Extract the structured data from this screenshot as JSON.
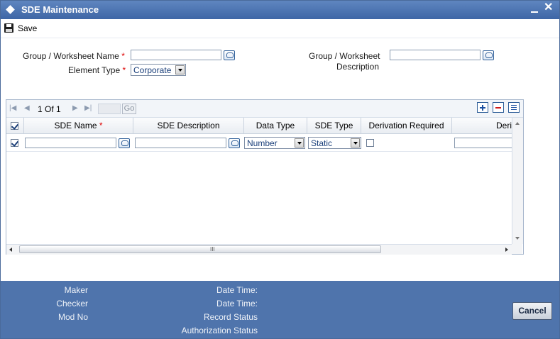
{
  "window": {
    "title": "SDE Maintenance"
  },
  "toolbar": {
    "save_label": "Save"
  },
  "form": {
    "group_name_label": "Group / Worksheet Name",
    "element_type_label": "Element Type",
    "element_type_value": "Corporate",
    "group_desc_label_line1": "Group / Worksheet",
    "group_desc_label_line2": "Description",
    "required_mark": "*"
  },
  "grid": {
    "page_current": "1",
    "page_of": "Of",
    "page_total": "1",
    "go_label": "Go",
    "columns": {
      "sde_name": "SDE Name",
      "sde_description": "SDE Description",
      "data_type": "Data Type",
      "sde_type": "SDE Type",
      "derivation_required": "Derivation Required",
      "derivation_partial": "Deri"
    },
    "row": {
      "data_type_value": "Number",
      "sde_type_value": "Static"
    },
    "scroll_grip": "III"
  },
  "footer": {
    "maker": "Maker",
    "checker": "Checker",
    "mod_no": "Mod No",
    "date_time_1": "Date Time:",
    "date_time_2": "Date Time:",
    "record_status": "Record Status",
    "authorization_status": "Authorization Status",
    "cancel_label": "Cancel"
  },
  "colors": {
    "titlebar": "#4a72b0",
    "footer": "#4f74ac",
    "required": "#dd0000"
  }
}
